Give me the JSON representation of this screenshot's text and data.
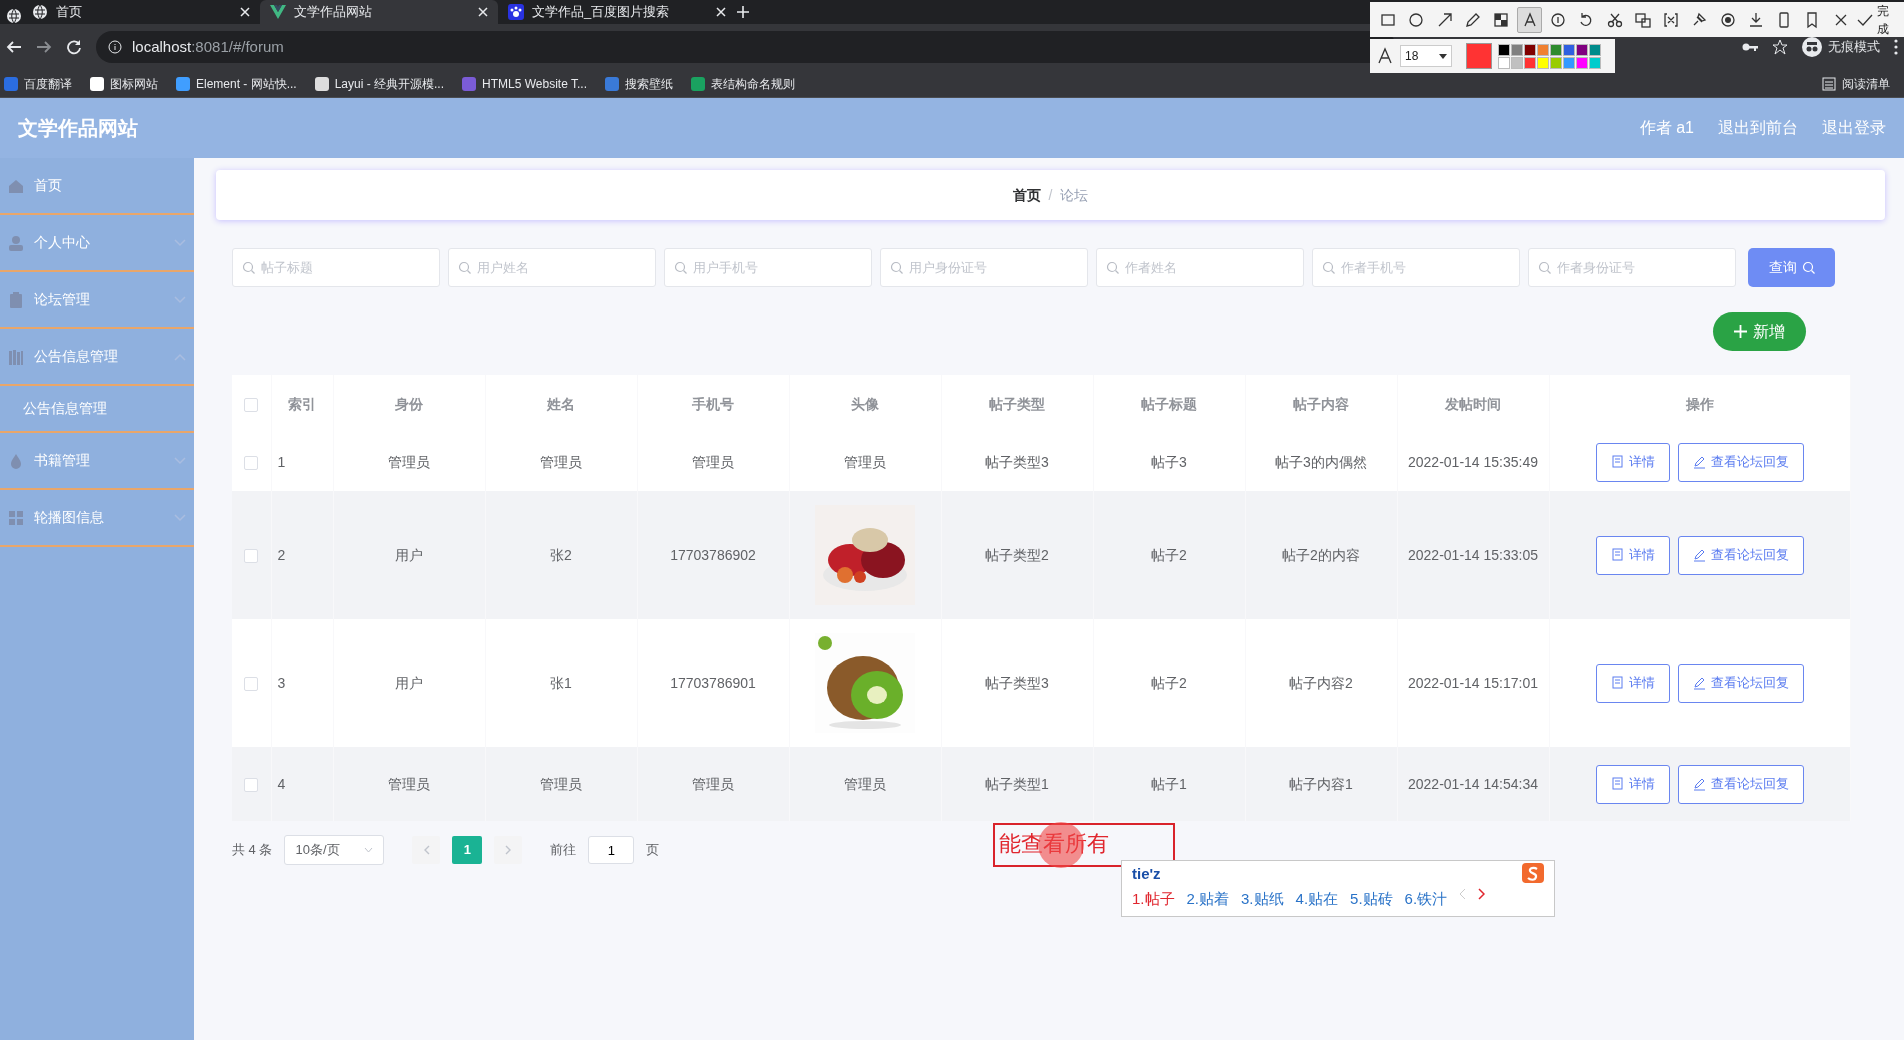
{
  "browser": {
    "tabs": [
      {
        "title": "首页",
        "kind": "globe",
        "selected": false
      },
      {
        "title": "文学作品网站",
        "kind": "vue",
        "selected": true
      },
      {
        "title": "文学作品_百度图片搜索",
        "kind": "paw",
        "selected": false
      }
    ],
    "url_host": "localhost",
    "url_rest": ":8081/#/forum",
    "bookmarks": [
      {
        "label": "百度翻译",
        "color": "#2b6de0"
      },
      {
        "label": "图标网站",
        "color": "#ffffff"
      },
      {
        "label": "Element - 网站快...",
        "color": "#409eff"
      },
      {
        "label": "Layui - 经典开源模...",
        "color": "#dddddd"
      },
      {
        "label": "HTML5 Website T...",
        "color": "#7b5cd6"
      },
      {
        "label": "搜索壁纸",
        "color": "#3a7ad8"
      },
      {
        "label": "表结构命名规则",
        "color": "#1aa260"
      }
    ],
    "incognito": "无痕模式",
    "reading_list": "阅读清单"
  },
  "screenshot_toolbar": {
    "done": "完成",
    "font_size": "18",
    "current_swatch": {
      "color": "#ff3333"
    },
    "palette": [
      {
        "color": "#000000"
      },
      {
        "color": "#808080"
      },
      {
        "color": "#800000"
      },
      {
        "color": "#f08030"
      },
      {
        "color": "#2e8b2e"
      },
      {
        "color": "#2f5fe0"
      },
      {
        "color": "#800080"
      },
      {
        "color": "#008b8b"
      },
      {
        "color": "#ffffff"
      },
      {
        "color": "#c0c0c0"
      },
      {
        "color": "#ff3333"
      },
      {
        "color": "#ffff00"
      },
      {
        "color": "#99cc00"
      },
      {
        "color": "#3399ff"
      },
      {
        "color": "#ff00ff"
      },
      {
        "color": "#00cccc"
      }
    ]
  },
  "header": {
    "title": "文学作品网站",
    "links": [
      "作者 a1",
      "退出到前台",
      "退出登录"
    ]
  },
  "sidebar": {
    "items": [
      {
        "label": "首页",
        "kind": "home"
      },
      {
        "label": "个人中心",
        "kind": "user",
        "expanded": false
      },
      {
        "label": "论坛管理",
        "kind": "clipboard",
        "expanded": false
      },
      {
        "label": "公告信息管理",
        "kind": "books",
        "expanded": true,
        "children": [
          {
            "label": "公告信息管理"
          }
        ]
      },
      {
        "label": "书籍管理",
        "kind": "drop",
        "expanded": false
      },
      {
        "label": "轮播图信息",
        "kind": "grid",
        "expanded": false
      }
    ]
  },
  "breadcrumb": {
    "separator": "/",
    "items": [
      {
        "label": "首页",
        "selected": false
      },
      {
        "label": "论坛",
        "selected": true
      }
    ]
  },
  "search": {
    "fields": [
      {
        "placeholder": "帖子标题"
      },
      {
        "placeholder": "用户姓名"
      },
      {
        "placeholder": "用户手机号"
      },
      {
        "placeholder": "用户身份证号"
      },
      {
        "placeholder": "作者姓名"
      },
      {
        "placeholder": "作者手机号"
      },
      {
        "placeholder": "作者身份证号"
      }
    ],
    "button": "查询"
  },
  "add_button": "新增",
  "table": {
    "header_checked": false,
    "columns": [
      "索引",
      "身份",
      "姓名",
      "手机号",
      "头像",
      "帖子类型",
      "帖子标题",
      "帖子内容",
      "发帖时间",
      "操作"
    ],
    "rows": [
      {
        "checked": false,
        "cells": [
          "1",
          "管理员",
          "管理员",
          "管理员",
          "管理员",
          "帖子类型3",
          "帖子3",
          "帖子3的内偶然",
          "2022-01-14 15:35:49"
        ],
        "actions": [
          "详情",
          "查看论坛回复"
        ]
      },
      {
        "checked": false,
        "cells": [
          "2",
          "用户",
          "张2",
          "17703786902",
          {
            "kind": "picture"
          },
          "帖子类型2",
          "帖子2",
          "帖子2的内容",
          "2022-01-14 15:33:05"
        ],
        "actions": [
          "详情",
          "查看论坛回复"
        ]
      },
      {
        "checked": false,
        "cells": [
          "3",
          "用户",
          "张1",
          "17703786901",
          {
            "kind": "picture"
          },
          "帖子类型3",
          "帖子2",
          "帖子内容2",
          "2022-01-14 15:17:01"
        ],
        "actions": [
          "详情",
          "查看论坛回复"
        ]
      },
      {
        "checked": false,
        "cells": [
          "4",
          "管理员",
          "管理员",
          "管理员",
          "管理员",
          "帖子类型1",
          "帖子1",
          "帖子内容1",
          "2022-01-14 14:54:34"
        ],
        "actions": [
          "详情",
          "查看论坛回复"
        ]
      }
    ]
  },
  "pagination": {
    "total": "共 4 条",
    "page_size": "10条/页",
    "pages": [
      {
        "label": "1",
        "selected": true
      }
    ],
    "goto_label": "前往",
    "goto_value": "1",
    "page_suffix": "页"
  },
  "annotation": {
    "text": "能查看所有"
  },
  "ime": {
    "input": "tie'z",
    "candidates": [
      {
        "label": "1.帖子",
        "selected": true
      },
      {
        "label": "2.贴着",
        "selected": false
      },
      {
        "label": "3.贴纸",
        "selected": false
      },
      {
        "label": "4.贴在",
        "selected": false
      },
      {
        "label": "5.贴砖",
        "selected": false
      },
      {
        "label": "6.铁汁",
        "selected": false
      }
    ]
  }
}
